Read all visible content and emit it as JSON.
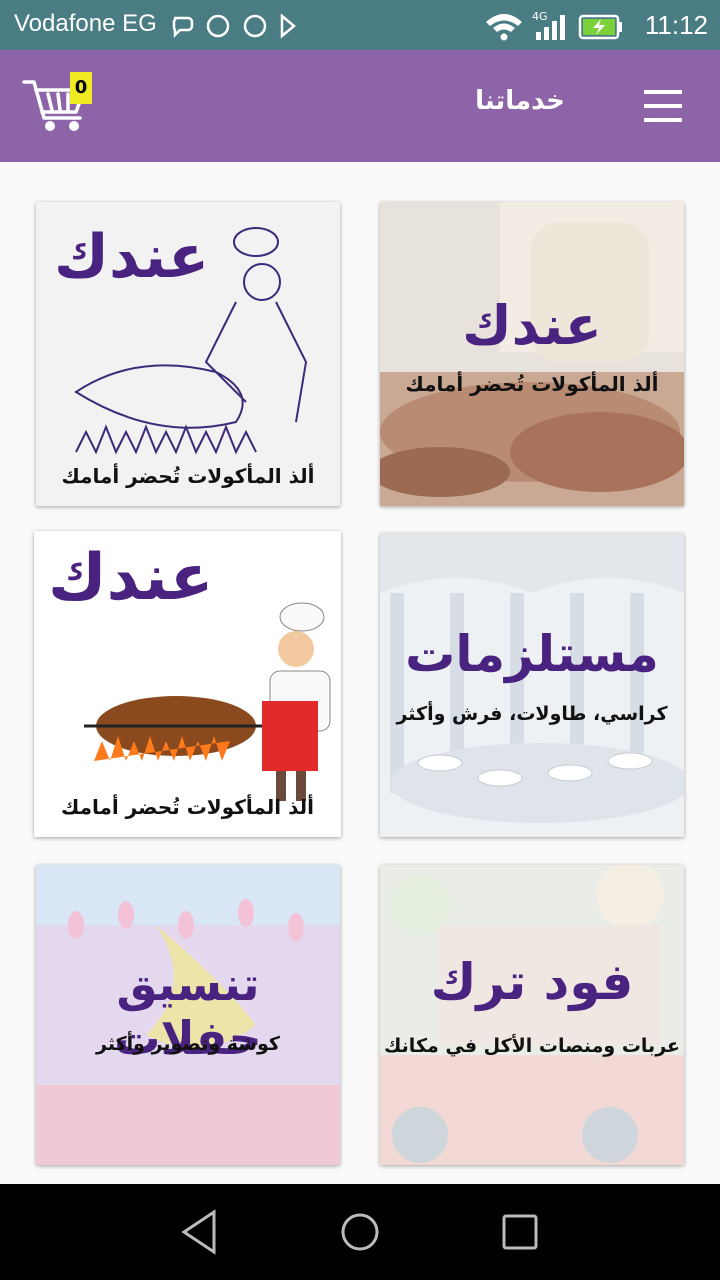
{
  "status_bar": {
    "carrier": "Vodafone EG",
    "network": "4G",
    "time": "11:12"
  },
  "app_bar": {
    "title": "خدماتنا",
    "cart_count": "0",
    "menu_icon": "hamburger-menu-icon",
    "cart_icon": "shopping-cart-icon"
  },
  "colors": {
    "app_bar": "#8e64a8",
    "status_bar": "#4a7c84",
    "brand_text": "#4a2380",
    "badge": "#f0ea23"
  },
  "cards": [
    {
      "brand": "عندك",
      "tagline": "ألذ المأكولات تُحضر أمامك"
    },
    {
      "brand": "عندك",
      "tagline": "ألذ المأكولات تُحضر أمامك"
    },
    {
      "brand": "مستلزمات",
      "tagline": "كراسي، طاولات، فرش وأكثر"
    },
    {
      "brand": "عندك",
      "tagline": "ألذ المأكولات تُحضر أمامك"
    },
    {
      "brand": "فود ترك",
      "tagline": "عربات ومنصات الأكل في مكانك"
    },
    {
      "brand": "تنسيق حفلات",
      "tagline": "كوشة وتصوير وأكثر"
    }
  ],
  "nav_bar": {
    "back_icon": "back-triangle-icon",
    "home_icon": "home-circle-icon",
    "recents_icon": "recents-square-icon"
  }
}
